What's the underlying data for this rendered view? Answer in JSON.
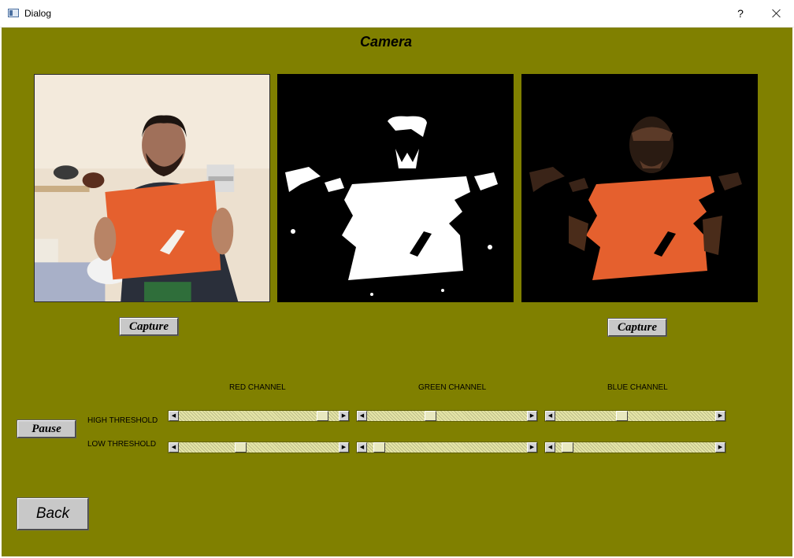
{
  "window": {
    "title": "Dialog",
    "help_label": "?",
    "close_icon": "close-icon"
  },
  "heading": "Camera",
  "buttons": {
    "capture_left": "Capture",
    "capture_right": "Capture",
    "pause": "Pause",
    "back": "Back"
  },
  "channels": [
    "RED CHANNEL",
    "GREEN CHANNEL",
    "BLUE CHANNEL"
  ],
  "rows": [
    "HIGH THRESHOLD",
    "LOW THRESHOLD"
  ],
  "sliders": {
    "red_high": 0.93,
    "red_low": 0.38,
    "green_high": 0.39,
    "green_low": 0.04,
    "blue_high": 0.41,
    "blue_low": 0.04
  },
  "colors": {
    "background": "#808000",
    "pillow": "#e5602e"
  }
}
